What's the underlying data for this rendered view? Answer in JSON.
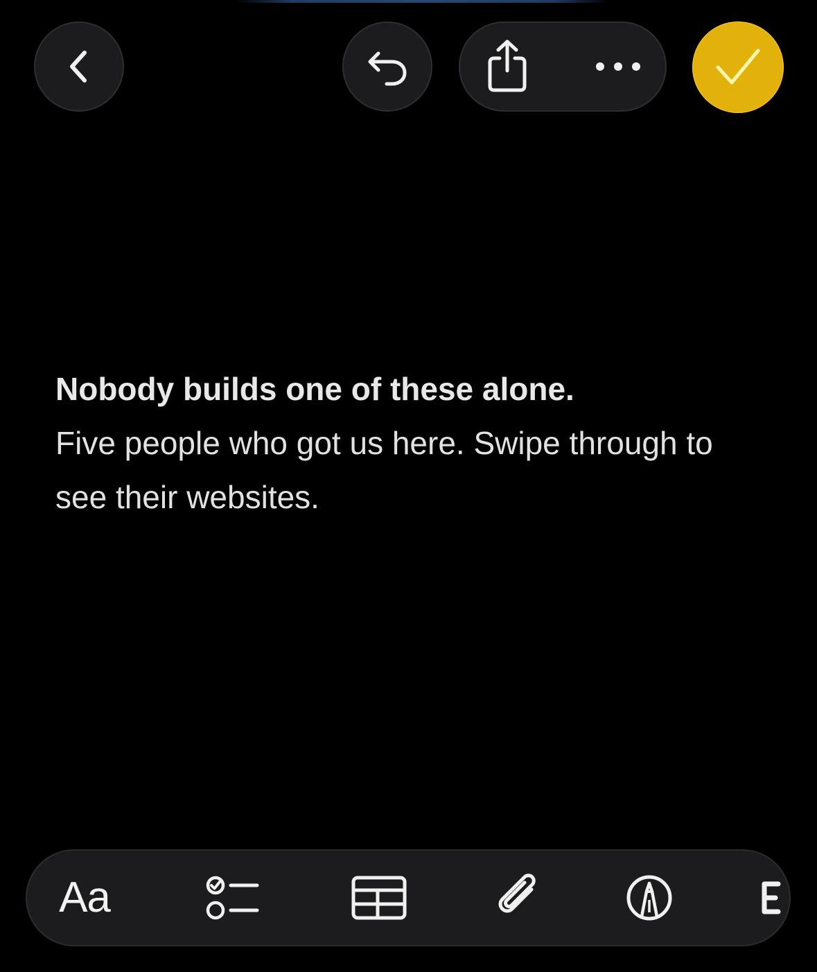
{
  "header": {
    "back_icon": "chevron-left-icon",
    "undo_icon": "undo-arrow-icon",
    "share_icon": "share-icon",
    "more_icon": "ellipsis-icon",
    "done_icon": "checkmark-icon",
    "done_color": "#e3b10b"
  },
  "note": {
    "title": "Nobody builds one of these alone.",
    "body": "Five people who got us here. Swipe through to see their websites."
  },
  "toolbar": {
    "format_label": "Aa",
    "checklist_icon": "checklist-icon",
    "table_icon": "table-icon",
    "attach_icon": "paperclip-icon",
    "markup_icon": "markup-pen-icon",
    "overflow_icon": "partially-visible-icon"
  },
  "colors": {
    "background": "#000000",
    "button_background": "#1c1c1e",
    "accent": "#e3b10b",
    "text": "#e6e6e6"
  }
}
